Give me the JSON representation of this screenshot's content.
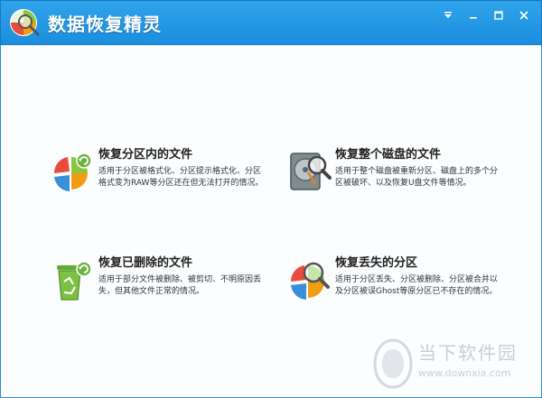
{
  "app": {
    "title": "数据恢复精灵"
  },
  "cards": [
    {
      "title": "恢复分区内的文件",
      "desc": "适用于分区被格式化、分区提示格式化、分区格式变为RAW等分区还在但无法打开的情况。"
    },
    {
      "title": "恢复整个磁盘的文件",
      "desc": "适用于整个磁盘被重新分区、磁盘上的多个分区被破坏、以及恢复U盘文件等情况。"
    },
    {
      "title": "恢复已删除的文件",
      "desc": "适用于部分文件被删除、被剪切、不明原因丢失，但其他文件正常的情况。"
    },
    {
      "title": "恢复丢失的分区",
      "desc": "适用于分区丢失、分区被删除、分区被合并以及分区被误Ghost等原分区已不存在的情况。"
    }
  ],
  "watermark": {
    "text": "当下软件园",
    "url": "www.downxia.com"
  },
  "colors": {
    "titlebar": "#1b8ede",
    "accent": "#2b8fd6"
  }
}
